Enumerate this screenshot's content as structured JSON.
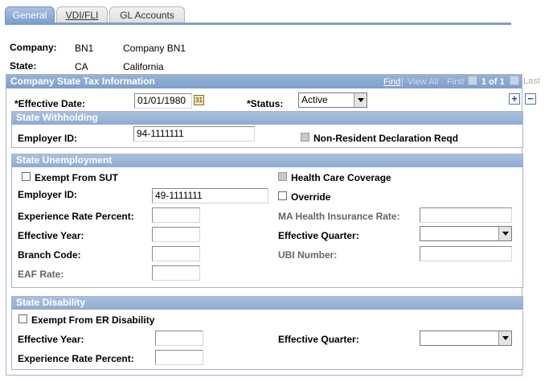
{
  "tabs": [
    {
      "label": "General",
      "active": true
    },
    {
      "label": "VDI/FLI",
      "active": false
    },
    {
      "label": "GL Accounts",
      "active": false
    }
  ],
  "header": {
    "company_label": "Company:",
    "company_code": "BN1",
    "company_name": "Company BN1",
    "state_label": "State:",
    "state_code": "CA",
    "state_name": "California"
  },
  "tax_info": {
    "title": "Company State Tax Information",
    "nav": {
      "find": "Find",
      "view_all": "View All",
      "first": "First",
      "count": "1 of 1",
      "last": "Last"
    },
    "effective_date_label": "*Effective Date:",
    "effective_date": "01/01/1980",
    "status_label": "*Status:",
    "status_value": "Active",
    "add_label": "+",
    "remove_label": "−"
  },
  "withholding": {
    "title": "State Withholding",
    "employer_id_label": "Employer ID:",
    "employer_id": "94-1111111",
    "non_resident_label": "Non-Resident Declaration Reqd"
  },
  "unemployment": {
    "title": "State Unemployment",
    "exempt_label": "Exempt From SUT",
    "health_label": "Health Care Coverage",
    "employer_id_label": "Employer ID:",
    "employer_id": "49-1111111",
    "override_label": "Override",
    "exp_rate_label": "Experience Rate Percent:",
    "ma_health_label": "MA Health Insurance Rate:",
    "eff_year_label": "Effective Year:",
    "eff_quarter_label": "Effective Quarter:",
    "branch_label": "Branch Code:",
    "ubi_label": "UBI Number:",
    "eaf_label": "EAF Rate:"
  },
  "disability": {
    "title": "State Disability",
    "exempt_label": "Exempt From ER Disability",
    "eff_year_label": "Effective Year:",
    "eff_quarter_label": "Effective Quarter:",
    "exp_rate_label": "Experience Rate Percent:"
  }
}
